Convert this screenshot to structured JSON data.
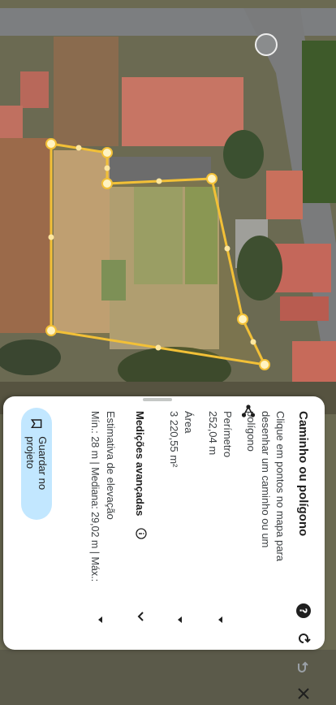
{
  "panel": {
    "title": "Caminho ou polígono",
    "description": "Clique em pontos no mapa para desenhar um caminho ou um polígono",
    "perimeter_label": "Perímetro",
    "perimeter_value": "252,04 m",
    "area_label": "Área",
    "area_value": "3 220,55 m²",
    "advanced_label": "Medições avançadas",
    "elevation_label": "Estimativa de elevação",
    "elevation_value": "Mín.: 28 m | Mediana: 29,02 m | Máx.:",
    "save_label": "Guardar no projeto"
  },
  "icons": [
    "share-node-icon",
    "help-icon",
    "redo-icon",
    "undo-icon",
    "close-icon",
    "info-icon",
    "bookmark-icon"
  ],
  "colors": {
    "polygon": "#f2c037",
    "save_button": "#c2e7ff",
    "help": "#1f1f1f"
  }
}
